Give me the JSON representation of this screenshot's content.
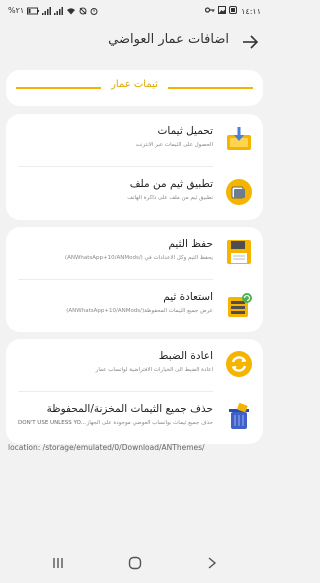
{
  "status": {
    "time": "١٤:١١",
    "battery": "%٢١",
    "key_icon": "key-icon",
    "image_icon": "image-icon",
    "notification_icon": "notification-icon"
  },
  "appbar": {
    "title": "اضافات عمار العواضي",
    "back_icon": "back-arrow-icon"
  },
  "banner": {
    "label": "ثيمات عمار"
  },
  "group1": [
    {
      "title": "تحميل ثيمات",
      "subtitle": "الحصول على الثيمات عبر الانترنت",
      "icon": "download-themes-icon"
    },
    {
      "title": "تطبيق ثيم من ملف",
      "subtitle": "تطبيق ثيم من ملف على ذاكرة الهاتف",
      "icon": "apply-file-theme-icon"
    }
  ],
  "group2": [
    {
      "title": "حفظ الثيم",
      "subtitle": "يحفظ الثيم وكل الاعدادات في (/ANWhatsApp+10/ANMods)",
      "icon": "save-theme-icon"
    },
    {
      "title": "استعادة ثيم",
      "subtitle": "عرض جميع الثيمات المحفوظة(/ANWhatsApp+10/ANMods)",
      "icon": "restore-theme-icon"
    }
  ],
  "group3": [
    {
      "title": "اعادة الضبط",
      "subtitle": "اعادة الضبط الى الخيارات الافتراضية لواتساب عمار",
      "icon": "reset-icon"
    },
    {
      "title": "حذف جميع الثيمات المخزنة/المحفوظة",
      "subtitle": "حذف جميع ثيمات بواتساب العوضي موجودة على الجهاز",
      "warning": "DON'T USE UNLESS YO...",
      "icon": "delete-themes-icon"
    }
  ],
  "location": "location: /storage/emulated/0/Download/ANThemes/",
  "navbar": {
    "recents_icon": "recents-icon",
    "home_icon": "home-icon",
    "back_icon": "nav-back-icon"
  },
  "colors": {
    "accent": "#f2b400",
    "background": "#f2f2f2",
    "card": "#ffffff"
  }
}
